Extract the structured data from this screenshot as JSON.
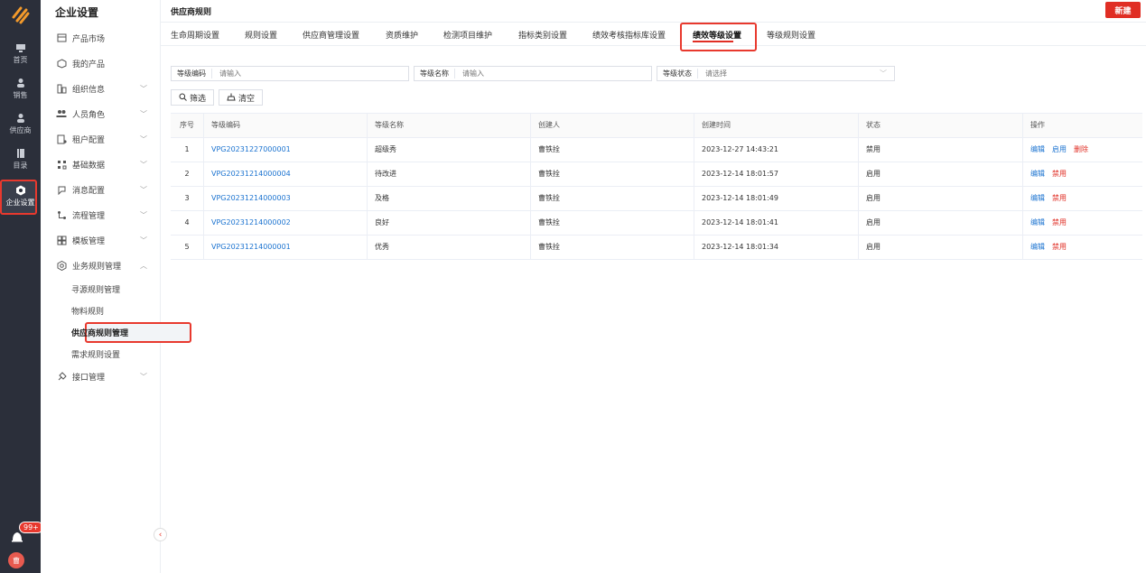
{
  "rail": {
    "items": [
      {
        "label": "首页",
        "icon": "monitor-icon"
      },
      {
        "label": "销售",
        "icon": "person-icon"
      },
      {
        "label": "供应商",
        "icon": "person-icon"
      },
      {
        "label": "目录",
        "icon": "book-icon"
      },
      {
        "label": "企业设置",
        "icon": "settings-hex-icon"
      }
    ],
    "badge": "99+",
    "avatar": "曹"
  },
  "sidebar": {
    "title": "企业设置",
    "items": [
      {
        "label": "产品市场",
        "icon": "store-icon"
      },
      {
        "label": "我的产品",
        "icon": "cube-icon"
      },
      {
        "label": "组织信息",
        "icon": "org-icon",
        "chevron": "﹀"
      },
      {
        "label": "人员角色",
        "icon": "people-icon",
        "chevron": "﹀"
      },
      {
        "label": "租户配置",
        "icon": "tenant-icon",
        "chevron": "﹀"
      },
      {
        "label": "基础数据",
        "icon": "data-icon",
        "chevron": "﹀"
      },
      {
        "label": "消息配置",
        "icon": "message-icon",
        "chevron": "﹀"
      },
      {
        "label": "流程管理",
        "icon": "flow-icon",
        "chevron": "﹀"
      },
      {
        "label": "模板管理",
        "icon": "template-icon",
        "chevron": "﹀"
      },
      {
        "label": "业务规则管理",
        "icon": "gear-icon",
        "chevron": "︿"
      }
    ],
    "sub_items": [
      "寻源规则管理",
      "物料规则",
      "供应商规则管理",
      "需求规则设置"
    ],
    "last_item": {
      "label": "接口管理",
      "icon": "plug-icon",
      "chevron": "﹀"
    }
  },
  "header": {
    "title": "供应商规则",
    "new_label": "新建"
  },
  "tabs": [
    "生命周期设置",
    "规则设置",
    "供应商管理设置",
    "资质维护",
    "检测项目维护",
    "指标类别设置",
    "绩效考核指标库设置",
    "绩效等级设置",
    "等级规则设置"
  ],
  "filters": {
    "code": {
      "label": "等级编码",
      "placeholder": "请输入"
    },
    "name": {
      "label": "等级名称",
      "placeholder": "请输入"
    },
    "status": {
      "label": "等级状态",
      "placeholder": "请选择"
    },
    "filter_btn": "筛选",
    "clear_btn": "清空"
  },
  "table": {
    "headers": [
      "序号",
      "等级编码",
      "等级名称",
      "创建人",
      "创建时间",
      "状态",
      "操作"
    ],
    "rows": [
      {
        "no": "1",
        "code": "VPG20231227000001",
        "name": "超级秀",
        "creator": "曹铁拴",
        "time": "2023-12-27 14:43:21",
        "status": "禁用",
        "ops": [
          "编辑",
          "启用",
          "删除"
        ]
      },
      {
        "no": "2",
        "code": "VPG20231214000004",
        "name": "待改进",
        "creator": "曹铁拴",
        "time": "2023-12-14 18:01:57",
        "status": "启用",
        "ops": [
          "编辑",
          "禁用"
        ]
      },
      {
        "no": "3",
        "code": "VPG20231214000003",
        "name": "及格",
        "creator": "曹铁拴",
        "time": "2023-12-14 18:01:49",
        "status": "启用",
        "ops": [
          "编辑",
          "禁用"
        ]
      },
      {
        "no": "4",
        "code": "VPG20231214000002",
        "name": "良好",
        "creator": "曹铁拴",
        "time": "2023-12-14 18:01:41",
        "status": "启用",
        "ops": [
          "编辑",
          "禁用"
        ]
      },
      {
        "no": "5",
        "code": "VPG20231214000001",
        "name": "优秀",
        "creator": "曹铁拴",
        "time": "2023-12-14 18:01:34",
        "status": "启用",
        "ops": [
          "编辑",
          "禁用"
        ]
      }
    ]
  },
  "colors": {
    "accent": "#e02e24",
    "link": "#1b73d0",
    "rail": "#2b2f3a"
  }
}
